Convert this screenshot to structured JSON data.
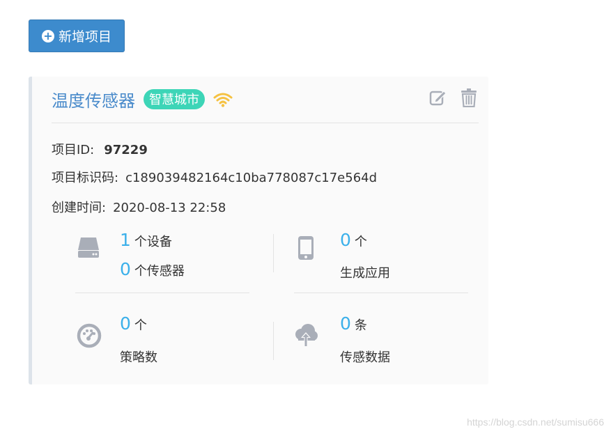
{
  "toolbar": {
    "add_label": "新增项目"
  },
  "project": {
    "title": "温度传感器",
    "tag": "智慧城市",
    "id_label": "项目ID:",
    "id_value": "97229",
    "code_label": "项目标识码:",
    "code_value": "c189039482164c10ba778087c17e564d",
    "created_label": "创建时间:",
    "created_value": "2020-08-13 22:58"
  },
  "stats": {
    "devices": {
      "count": "1",
      "unit": "个设备"
    },
    "sensors": {
      "count": "0",
      "unit": "个传感器"
    },
    "apps": {
      "count": "0",
      "unit": "个",
      "label": "生成应用"
    },
    "strategies": {
      "count": "0",
      "unit": "个",
      "label": "策略数"
    },
    "sensor_data": {
      "count": "0",
      "unit": "条",
      "label": "传感数据"
    }
  },
  "watermark": "https://blog.csdn.net/sumisu666",
  "colors": {
    "primary_button": "#3d8bcd",
    "title": "#4a8bcb",
    "tag_bg": "#3dd5b7",
    "wifi": "#f5c242",
    "number": "#3bb0ea",
    "icon_gray": "#a9aeb8"
  },
  "icons": {
    "add": "plus-circle-icon",
    "wifi": "wifi-icon",
    "edit": "edit-icon",
    "delete": "trash-icon",
    "device": "hard-drive-icon",
    "app": "mobile-phone-icon",
    "strategy": "dashboard-icon",
    "data": "cloud-upload-icon"
  }
}
